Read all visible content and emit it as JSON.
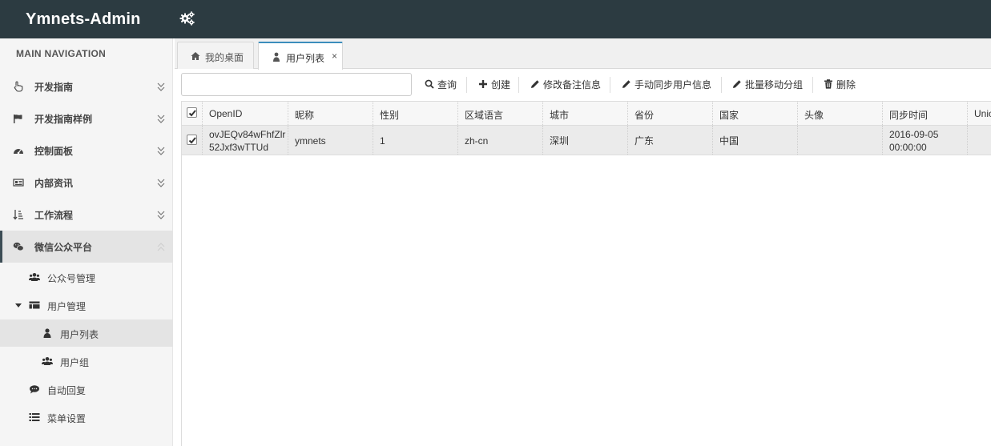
{
  "header": {
    "brand": "Ymnets-Admin",
    "settings_icon": "gears-icon"
  },
  "sidebar": {
    "heading": "MAIN NAVIGATION",
    "items": [
      {
        "label": "开发指南",
        "icon": "hand-pointer-icon"
      },
      {
        "label": "开发指南样例",
        "icon": "flag-icon"
      },
      {
        "label": "控制面板",
        "icon": "dashboard-icon"
      },
      {
        "label": "内部资讯",
        "icon": "newspaper-icon"
      },
      {
        "label": "工作流程",
        "icon": "sort-list-icon"
      },
      {
        "label": "微信公众平台",
        "icon": "wechat-icon"
      }
    ],
    "sub_items": [
      {
        "label": "公众号管理",
        "icon": "users-icon"
      },
      {
        "label": "用户管理",
        "icon": "table-icon"
      },
      {
        "label": "用户列表",
        "icon": "user-icon"
      },
      {
        "label": "用户组",
        "icon": "users-icon"
      },
      {
        "label": "自动回复",
        "icon": "comment-icon"
      },
      {
        "label": "菜单设置",
        "icon": "list-icon"
      }
    ]
  },
  "tabs": [
    {
      "label": "我的桌面",
      "icon": "home-icon"
    },
    {
      "label": "用户列表",
      "icon": "user-icon",
      "close": "×"
    }
  ],
  "toolbar": {
    "search_value": "",
    "buttons": [
      {
        "label": "查询",
        "icon": "search-icon"
      },
      {
        "label": "创建",
        "icon": "plus-icon"
      },
      {
        "label": "修改备注信息",
        "icon": "pencil-icon"
      },
      {
        "label": "手动同步用户信息",
        "icon": "pencil-icon"
      },
      {
        "label": "批量移动分组",
        "icon": "pencil-icon"
      },
      {
        "label": "删除",
        "icon": "trash-icon"
      }
    ]
  },
  "grid": {
    "header_checked": true,
    "columns": [
      "OpenID",
      "昵称",
      "性别",
      "区域语言",
      "城市",
      "省份",
      "国家",
      "头像",
      "同步时间",
      "UnionID"
    ],
    "rows": [
      {
        "checked": true,
        "openid_line1": "ovJEQv84wFhfZlr",
        "openid_line2": "52Jxf3wTTUd",
        "nickname": "ymnets",
        "sex": "1",
        "language": "zh-cn",
        "city": "深圳",
        "province": "广东",
        "country": "中国",
        "avatar": "",
        "sync_date": "2016-09-05",
        "sync_time": "00:00:00",
        "unionid": ""
      }
    ]
  }
}
